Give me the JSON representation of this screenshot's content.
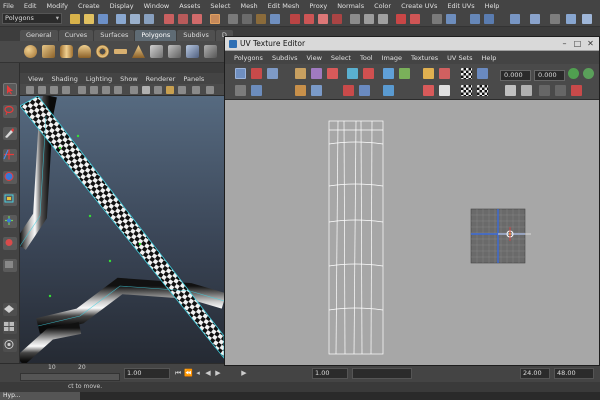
{
  "main_menu": [
    "File",
    "Edit",
    "Modify",
    "Create",
    "Display",
    "Window",
    "Assets",
    "Select",
    "Mesh",
    "Edit Mesh",
    "Proxy",
    "Normals",
    "Color",
    "Create UVs",
    "Edit UVs",
    "Help"
  ],
  "mode_selector": {
    "value": "Polygons"
  },
  "shelf_tabs": [
    {
      "label": "General",
      "active": false
    },
    {
      "label": "Curves",
      "active": false
    },
    {
      "label": "Surfaces",
      "active": false
    },
    {
      "label": "Polygons",
      "active": true
    },
    {
      "label": "Subdivs",
      "active": false
    },
    {
      "label": "D",
      "active": false
    }
  ],
  "viewport_menu": [
    "View",
    "Shading",
    "Lighting",
    "Show",
    "Renderer",
    "Panels"
  ],
  "uv_editor": {
    "title": "UV Texture Editor",
    "menu": [
      "Polygons",
      "Subdivs",
      "View",
      "Select",
      "Tool",
      "Image",
      "Textures",
      "UV Sets",
      "Help"
    ],
    "field_u": "0.000",
    "field_v": "0.000"
  },
  "time_slider": {
    "tick_10": "10",
    "tick_20": "20",
    "current_time": "1.00",
    "range_start": "1.00",
    "range_end": "24.00",
    "anim_end": "48.00"
  },
  "help_line": "ct to move.",
  "taskbar": {
    "item": "Hyp..."
  },
  "icons": [
    "select-arrow-icon",
    "lasso-icon",
    "paint-icon",
    "move-icon",
    "rotate-icon",
    "scale-icon",
    "uv-grid-icon",
    "checker-icon"
  ],
  "colors": {
    "checker_dark": "#111111",
    "checker_light": "#f2f2f2",
    "uv_background": "#a7a7a7",
    "wire_cyan": "#3fd0e0"
  }
}
